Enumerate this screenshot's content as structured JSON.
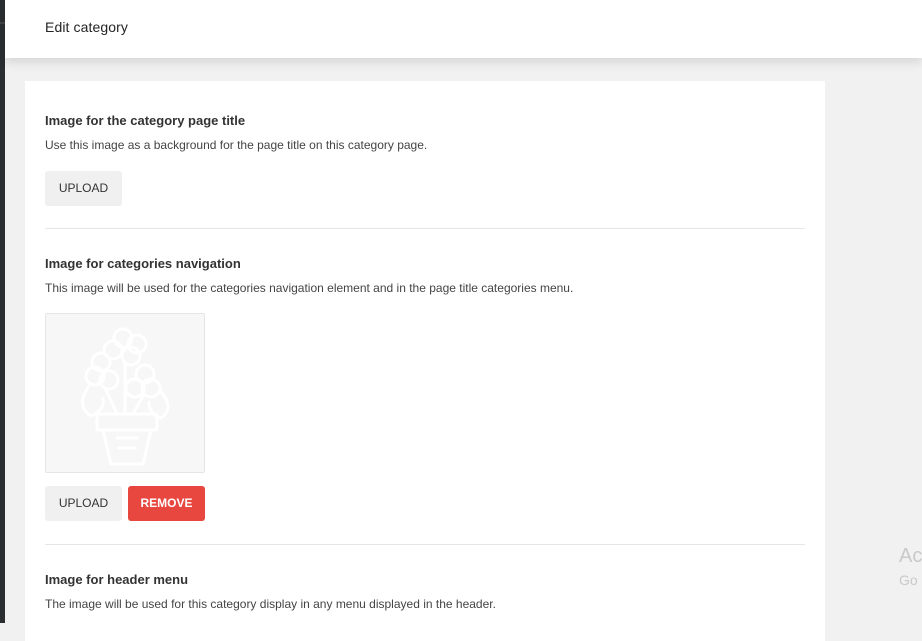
{
  "header": {
    "title": "Edit category"
  },
  "sections": [
    {
      "title": "Image for the category page title",
      "description": "Use this image as a background for the page title on this category page.",
      "upload_label": "UPLOAD"
    },
    {
      "title": "Image for categories navigation",
      "description": "This image will be used for the categories navigation element and in the page title categories menu.",
      "thumbnail_icon": "flower-pot-icon",
      "upload_label": "UPLOAD",
      "remove_label": "REMOVE"
    },
    {
      "title": "Image for header menu",
      "description": "The image will be used for this category display in any menu displayed in the header."
    }
  ],
  "watermark": {
    "line1": "Ac",
    "line2": "Go"
  },
  "colors": {
    "remove": "#e8473f",
    "upload_bg": "#f0f0f0",
    "page_bg": "#f1f1f1"
  }
}
